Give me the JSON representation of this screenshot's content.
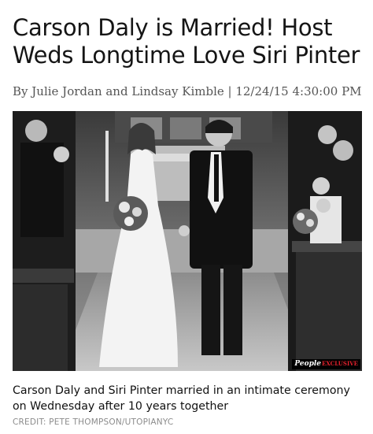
{
  "article": {
    "headline": "Carson Daly is Married! Host Weds Longtime Love Siri Pinter",
    "byline": "By Julie Jordan and Lindsay Kimble | 12/24/15 4:30:00 PM",
    "photo_badge": {
      "brand": "People",
      "tag": "EXCLUSIVE"
    },
    "caption": "Carson Daly and Siri Pinter married in an intimate ceremony on Wednesday after 10 years together",
    "credit": "CREDIT: PETE THOMPSON/UTOPIANYC"
  },
  "colors": {
    "text": "#111111",
    "byline": "#555555",
    "credit": "#8c8c8c",
    "badge_accent": "#e2202c"
  },
  "icons": [
    "people-logo"
  ]
}
